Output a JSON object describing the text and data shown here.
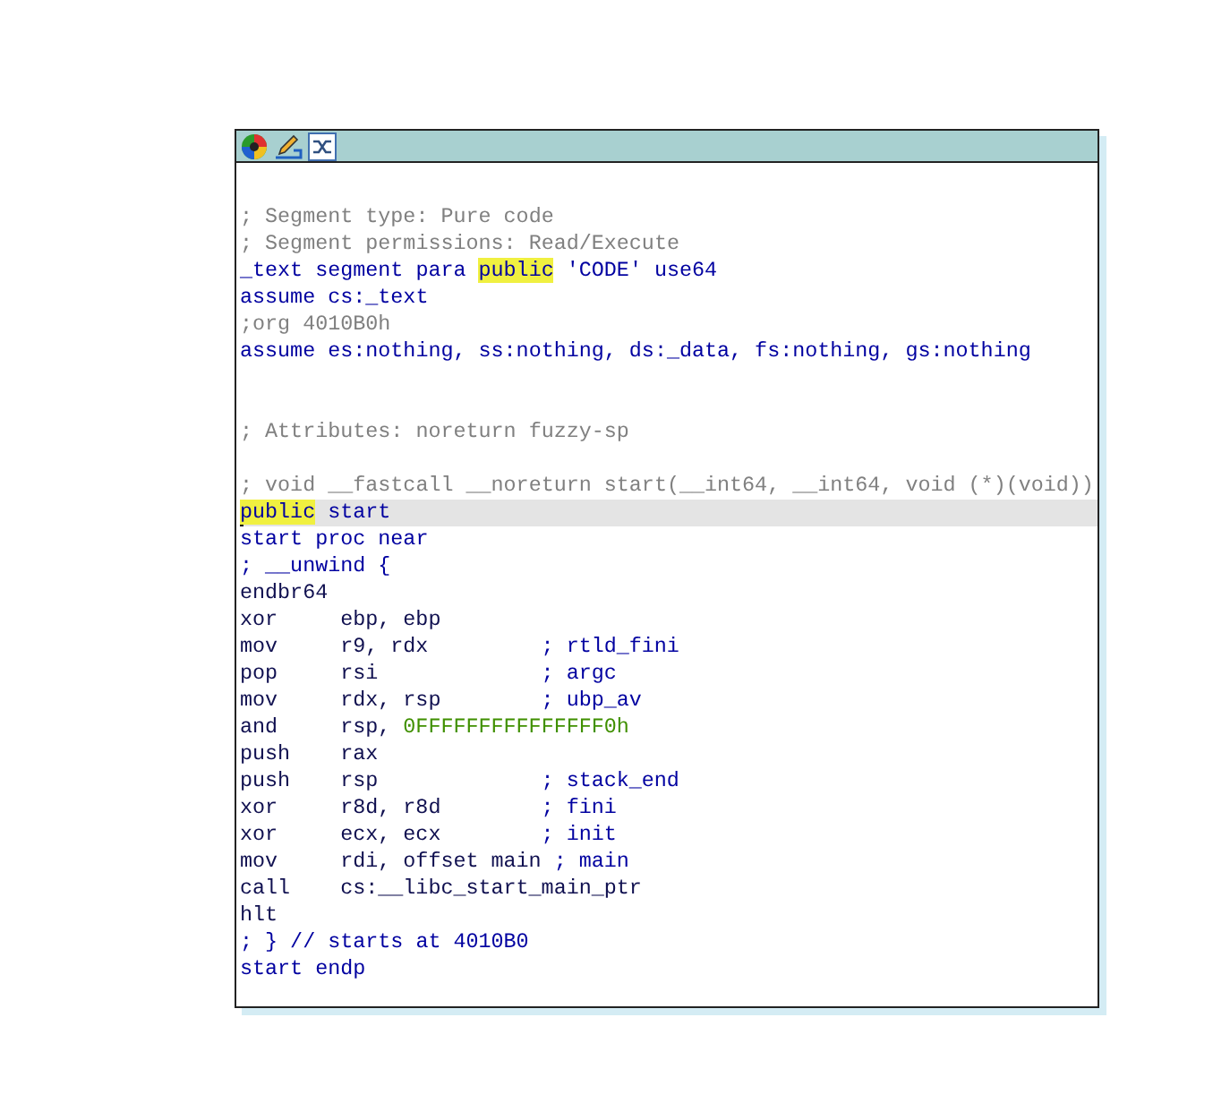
{
  "toolbar": {
    "buttons": [
      {
        "kind": "palette"
      },
      {
        "kind": "rename"
      },
      {
        "kind": "graph"
      }
    ]
  },
  "lines": [
    {
      "kind": "blank",
      "selected": false
    },
    {
      "kind": "comment",
      "selected": false,
      "parts": [
        {
          "text": "; Segment type: Pure code"
        }
      ]
    },
    {
      "kind": "comment",
      "selected": false,
      "parts": [
        {
          "text": "; Segment permissions: Read/Execute"
        }
      ]
    },
    {
      "kind": "directive",
      "selected": false,
      "parts": [
        {
          "text": "_text segment para "
        },
        {
          "text": "public",
          "highlight": true
        },
        {
          "text": " 'CODE' use64"
        }
      ]
    },
    {
      "kind": "directive",
      "selected": false,
      "parts": [
        {
          "text": "assume cs:_text"
        }
      ]
    },
    {
      "kind": "comment",
      "selected": false,
      "parts": [
        {
          "text": ";org 4010B0h"
        }
      ]
    },
    {
      "kind": "directive",
      "selected": false,
      "parts": [
        {
          "text": "assume es:nothing, ss:nothing, ds:_data, fs:nothing, gs:nothing"
        }
      ]
    },
    {
      "kind": "blank",
      "selected": false
    },
    {
      "kind": "blank",
      "selected": false
    },
    {
      "kind": "comment",
      "selected": false,
      "parts": [
        {
          "text": "; Attributes: noreturn fuzzy-sp"
        }
      ]
    },
    {
      "kind": "blank",
      "selected": false
    },
    {
      "kind": "comment",
      "selected": false,
      "parts": [
        {
          "text": "; void __fastcall __noreturn start(__int64, __int64, void (*)(void))"
        }
      ]
    },
    {
      "kind": "directive",
      "selected": true,
      "parts": [
        {
          "text": "public",
          "highlight": true
        },
        {
          "text": " start"
        }
      ]
    },
    {
      "kind": "directive",
      "selected": false,
      "parts": [
        {
          "text": "start proc near"
        }
      ]
    },
    {
      "kind": "directive",
      "selected": false,
      "parts": [
        {
          "text": "; __unwind {"
        }
      ]
    },
    {
      "kind": "insn",
      "selected": false,
      "mnemonic": "endbr64"
    },
    {
      "kind": "insn",
      "selected": false,
      "mnemonic": "xor",
      "operands": [
        {
          "text": "ebp, ebp"
        }
      ]
    },
    {
      "kind": "insn",
      "selected": false,
      "mnemonic": "mov",
      "operands": [
        {
          "text": "r9, rdx"
        }
      ],
      "comment": "; rtld_fini"
    },
    {
      "kind": "insn",
      "selected": false,
      "mnemonic": "pop",
      "operands": [
        {
          "text": "rsi"
        }
      ],
      "comment": "; argc"
    },
    {
      "kind": "insn",
      "selected": false,
      "mnemonic": "mov",
      "operands": [
        {
          "text": "rdx, rsp"
        }
      ],
      "comment": "; ubp_av"
    },
    {
      "kind": "insn",
      "selected": false,
      "mnemonic": "and",
      "operands": [
        {
          "text": "rsp,"
        },
        {
          "text": "0FFFFFFFFFFFFFFF0h",
          "number": true
        }
      ]
    },
    {
      "kind": "insn",
      "selected": false,
      "mnemonic": "push",
      "operands": [
        {
          "text": "rax"
        }
      ]
    },
    {
      "kind": "insn",
      "selected": false,
      "mnemonic": "push",
      "operands": [
        {
          "text": "rsp"
        }
      ],
      "comment": "; stack_end"
    },
    {
      "kind": "insn",
      "selected": false,
      "mnemonic": "xor",
      "operands": [
        {
          "text": "r8d, r8d"
        }
      ],
      "comment": "; fini"
    },
    {
      "kind": "insn",
      "selected": false,
      "mnemonic": "xor",
      "operands": [
        {
          "text": "ecx, ecx"
        }
      ],
      "comment": "; init"
    },
    {
      "kind": "insn",
      "selected": false,
      "mnemonic": "mov",
      "operands": [
        {
          "text": "rdi, offset main"
        }
      ],
      "comment": "; main"
    },
    {
      "kind": "insn",
      "selected": false,
      "mnemonic": "call",
      "operands": [
        {
          "text": "cs:__libc_start_main_ptr"
        }
      ]
    },
    {
      "kind": "insn",
      "selected": false,
      "mnemonic": "hlt"
    },
    {
      "kind": "directive",
      "selected": false,
      "parts": [
        {
          "text": "; } // starts at 4010B0"
        }
      ]
    },
    {
      "kind": "directive",
      "selected": false,
      "parts": [
        {
          "text": "start endp"
        }
      ]
    }
  ]
}
